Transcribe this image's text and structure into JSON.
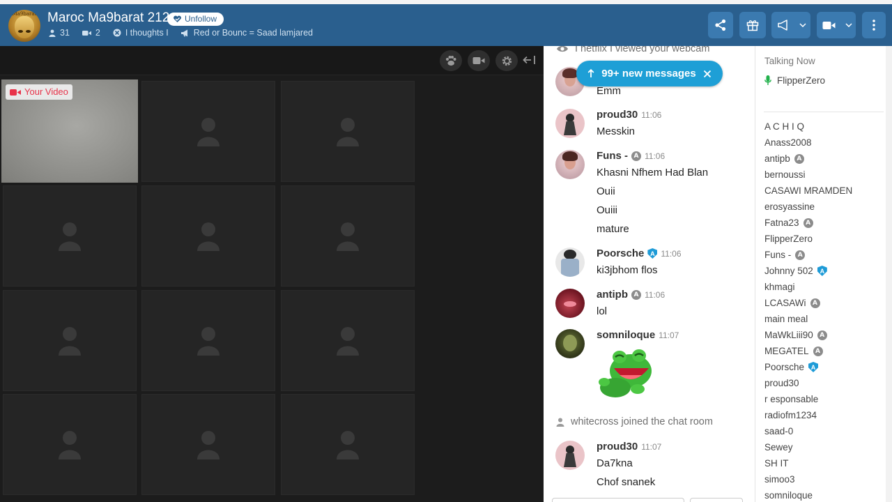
{
  "header": {
    "room_title": "Maroc Ma9barat 212",
    "avatar_text": "Ma9barat 212",
    "unfollow_label": "Unfollow",
    "users_count": "31",
    "cams_count": "2",
    "topic": "I thoughts I",
    "announcement": "Red or Bounc = Saad lamjared",
    "colors": {
      "bar": "#2a5f8e",
      "button": "#3b7ab0"
    },
    "icons": [
      "share-icon",
      "gift-icon",
      "megaphone-icon",
      "camera-icon",
      "more-icon"
    ]
  },
  "video": {
    "your_video_label": "Your Video",
    "toolbar_icons": [
      "paw-icon",
      "video-icon",
      "gear-icon",
      "collapse-icon"
    ]
  },
  "chat": {
    "new_messages_label": "99+ new messages",
    "accent": "#1e9fd6",
    "system_top": "I netflix I viewed your webcam",
    "partial_line": "Emm",
    "messages": [
      {
        "name": "proud30",
        "time": "11:06",
        "lines": [
          "Messkin"
        ]
      },
      {
        "name": "Funs -",
        "time": "11:06",
        "badge": "A",
        "lines": [
          "Khasni Nfhem Had Blan",
          "Ouii",
          "Ouiii",
          "mature"
        ]
      },
      {
        "name": "Poorsche",
        "time": "11:06",
        "badge": "shield",
        "lines": [
          "ki3jbhom flos"
        ]
      },
      {
        "name": "antipb",
        "time": "11:06",
        "badge": "A",
        "lines": [
          "lol"
        ]
      },
      {
        "name": "somniloque",
        "time": "11:07",
        "sticker": "laughing-frog-sticker"
      },
      {
        "name": "proud30",
        "time": "11:07",
        "lines": [
          "Da7kna",
          "Chof snanek"
        ]
      }
    ],
    "system_join": "whitecross joined the chat room"
  },
  "users": {
    "talking_now_label": "Talking Now",
    "talking_user": "FlipperZero",
    "list": [
      {
        "name": "A C H I Q"
      },
      {
        "name": "Anass2008"
      },
      {
        "name": "antipb",
        "badge": "A"
      },
      {
        "name": "bernoussi"
      },
      {
        "name": "CASAWI MRAMDEN"
      },
      {
        "name": "erosyassine"
      },
      {
        "name": "Fatna23",
        "badge": "A"
      },
      {
        "name": "FlipperZero"
      },
      {
        "name": "Funs -",
        "badge": "A"
      },
      {
        "name": "Johnny 502",
        "badge": "shield"
      },
      {
        "name": "khmagi"
      },
      {
        "name": "LCASAWi",
        "badge": "A"
      },
      {
        "name": "main meal"
      },
      {
        "name": "MaWkLiii90",
        "badge": "A"
      },
      {
        "name": "MEGATEL",
        "badge": "A"
      },
      {
        "name": "Poorsche",
        "badge": "shield"
      },
      {
        "name": "proud30"
      },
      {
        "name": "r esponsable"
      },
      {
        "name": "radiofm1234"
      },
      {
        "name": "saad-0"
      },
      {
        "name": "Sewey"
      },
      {
        "name": "SH IT"
      },
      {
        "name": "simoo3"
      },
      {
        "name": "somniloque"
      }
    ]
  }
}
